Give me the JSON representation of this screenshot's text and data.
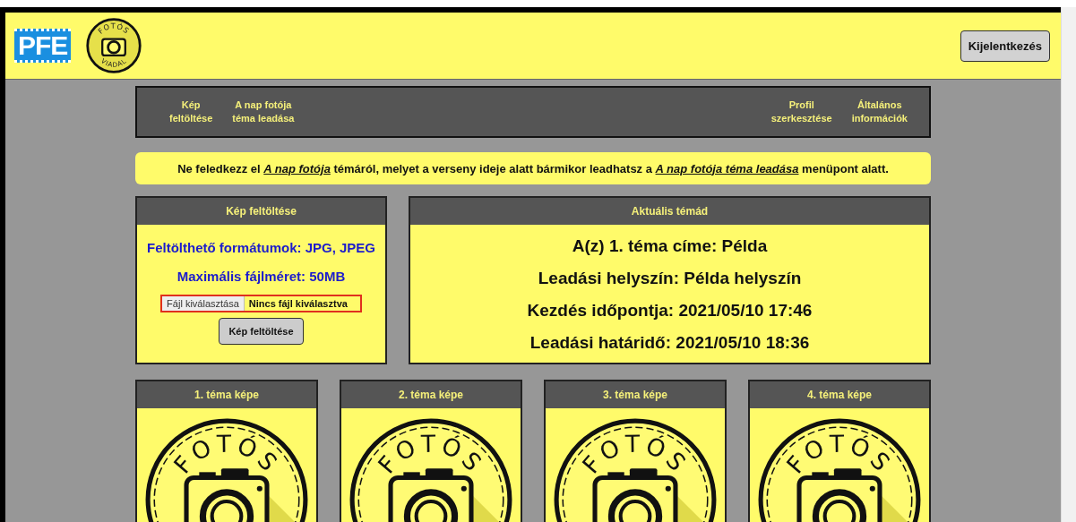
{
  "header": {
    "brand": "PFE",
    "logo_top": "FOTÓS",
    "logo_bottom": "VIADAL",
    "logout_button": "Kijelentkezés"
  },
  "nav": {
    "left": [
      {
        "line1": "Kép",
        "line2": "feltöltése"
      },
      {
        "line1": "A nap fotója",
        "line2": "téma leadása"
      }
    ],
    "right": [
      {
        "line1": "Profil",
        "line2": "szerkesztése"
      },
      {
        "line1": "Általános",
        "line2": "információk"
      }
    ]
  },
  "notice": [
    {
      "kind": "text",
      "text": "Ne feledkezz el "
    },
    {
      "kind": "link",
      "text": "A nap fotója"
    },
    {
      "kind": "text",
      "text": " témáról, melyet a verseny ideje alatt bármikor leadhatsz a "
    },
    {
      "kind": "link",
      "text": "A nap fotója téma leadása"
    },
    {
      "kind": "text",
      "text": " menüpont alatt."
    }
  ],
  "upload": {
    "title": "Kép feltöltése",
    "formats": "Feltölthető formátumok: JPG, JPEG",
    "max_size": "Maximális fájlméret: 50MB",
    "file_button": "Fájl kiválasztása",
    "file_status": "Nincs fájl kiválasztva",
    "submit": "Kép feltöltése"
  },
  "topic": {
    "title": "Aktuális témád",
    "lines": [
      "A(z) 1. téma címe: Példa",
      "Leadási helyszín: Példa helyszín",
      "Kezdés időpontja: 2021/05/10 17:46",
      "Leadási határidő: 2021/05/10 18:36"
    ]
  },
  "photos": [
    {
      "title": "1. téma képe",
      "logo_text": "FOTÓS"
    },
    {
      "title": "2. téma képe",
      "logo_text": "FOTÓS"
    },
    {
      "title": "3. téma képe",
      "logo_text": "FOTÓS"
    },
    {
      "title": "4. téma képe",
      "logo_text": "FOTÓS"
    }
  ]
}
